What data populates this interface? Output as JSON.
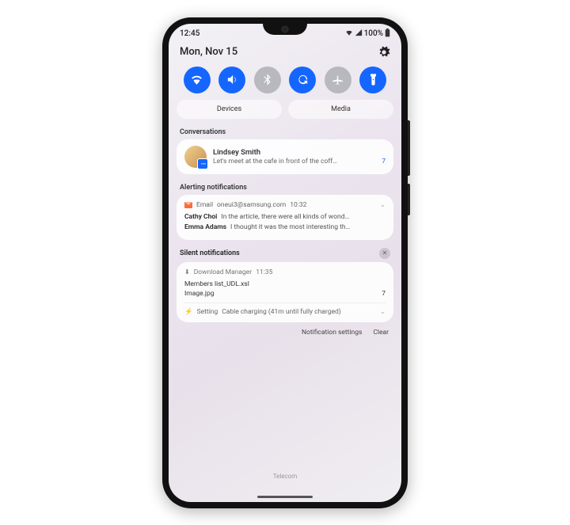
{
  "status": {
    "time": "12:45",
    "battery_text": "100%"
  },
  "header": {
    "date": "Mon, Nov 15"
  },
  "quick": {
    "toggles": [
      {
        "name": "wifi",
        "on": true
      },
      {
        "name": "sound",
        "on": true
      },
      {
        "name": "bluetooth",
        "on": false
      },
      {
        "name": "rotate",
        "on": true
      },
      {
        "name": "airplane",
        "on": false
      },
      {
        "name": "flashlight",
        "on": true
      }
    ],
    "devices_label": "Devices",
    "media_label": "Media"
  },
  "sections": {
    "conversations": "Conversations",
    "alerting": "Alerting notifications",
    "silent": "Silent notifications"
  },
  "conversation": {
    "name": "Lindsey Smith",
    "preview": "Let's meet at the cafe in front of the coff…",
    "count": "7"
  },
  "alerting": {
    "app_label": "Email",
    "from": "oneui3@samsung.com",
    "time": "10:32",
    "items": [
      {
        "sender": "Cathy Choi",
        "text": "In the article, there were all kinds of wond…"
      },
      {
        "sender": "Emma Adams",
        "text": "I thought it was the most interesting th…"
      }
    ]
  },
  "silent": {
    "dm_label": "Download Manager",
    "dm_time": "11:35",
    "files": [
      {
        "name": "Members list_UDL.xsl",
        "count": ""
      },
      {
        "name": "Image.jpg",
        "count": "7"
      }
    ],
    "setting_label": "Setting",
    "setting_text": "Cable charging (41m until fully charged)"
  },
  "footer": {
    "settings": "Notification settings",
    "clear": "Clear",
    "carrier": "Telecom"
  }
}
